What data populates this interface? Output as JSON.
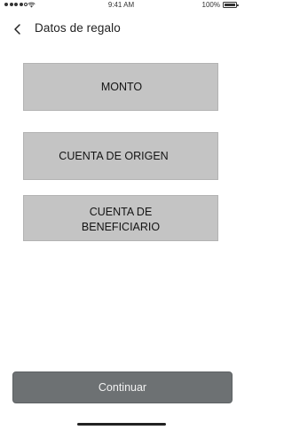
{
  "status_bar": {
    "time": "9:41 AM",
    "battery": "100%",
    "signal_bars": 4,
    "icons": [
      "signal-icon",
      "wifi-icon",
      "battery-icon"
    ]
  },
  "header": {
    "title": "Datos de regalo",
    "back_icon": "chevron-left-icon"
  },
  "options": {
    "monto": "MONTO",
    "cuenta_origen": "CUENTA DE ORIGEN",
    "cuenta_beneficiario": "CUENTA DE\nBENEFICIARIO"
  },
  "footer": {
    "continue_label": "Continuar"
  },
  "colors": {
    "card_background": "#c4c4c4",
    "button_background": "#6d7173",
    "button_text": "#f2f2f2"
  }
}
